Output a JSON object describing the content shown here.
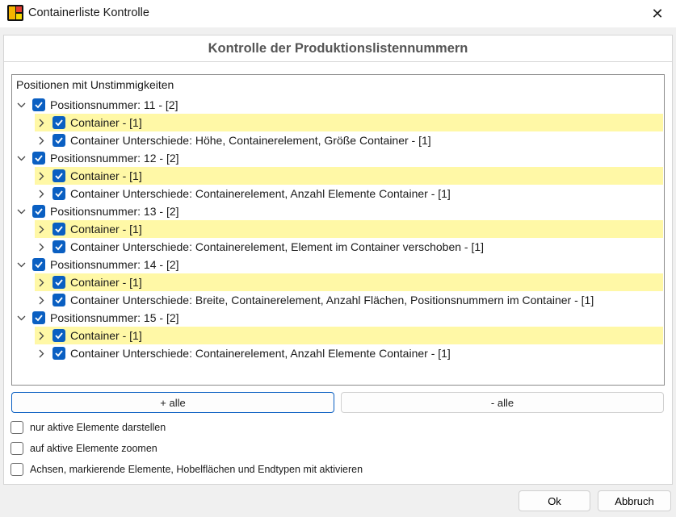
{
  "window": {
    "title": "Containerliste Kontrolle",
    "icon": "app-3d-icon",
    "close_icon": "close-icon"
  },
  "heading": "Kontrolle der Produktionslistennummern",
  "tree": {
    "caption": "Positionen mit Unstimmigkeiten",
    "groups": [
      {
        "label": "Positionsnummer: 11 - [2]",
        "children": [
          {
            "label": "Container  - [1]",
            "highlight": true
          },
          {
            "label": "Container Unterschiede: Höhe, Containerelement, Größe Container - [1]",
            "highlight": false
          }
        ]
      },
      {
        "label": "Positionsnummer: 12 - [2]",
        "children": [
          {
            "label": "Container  - [1]",
            "highlight": true
          },
          {
            "label": "Container Unterschiede: Containerelement, Anzahl Elemente Container - [1]",
            "highlight": false
          }
        ]
      },
      {
        "label": "Positionsnummer: 13 - [2]",
        "children": [
          {
            "label": "Container  - [1]",
            "highlight": true
          },
          {
            "label": "Container Unterschiede: Containerelement, Element im Container verschoben - [1]",
            "highlight": false
          }
        ]
      },
      {
        "label": "Positionsnummer: 14 - [2]",
        "children": [
          {
            "label": "Container  - [1]",
            "highlight": true
          },
          {
            "label": "Container Unterschiede: Breite, Containerelement, Anzahl Flächen, Positionsnummern im Container - [1]",
            "highlight": false
          }
        ]
      },
      {
        "label": "Positionsnummer: 15 - [2]",
        "children": [
          {
            "label": "Container  - [1]",
            "highlight": true
          },
          {
            "label": "Container Unterschiede: Containerelement, Anzahl Elemente Container - [1]",
            "highlight": false
          }
        ]
      }
    ]
  },
  "buttons": {
    "add_all": "+ alle",
    "remove_all": "- alle",
    "ok": "Ok",
    "cancel": "Abbruch"
  },
  "options": [
    {
      "label": "nur aktive Elemente darstellen",
      "checked": false
    },
    {
      "label": "auf aktive Elemente zoomen",
      "checked": false
    },
    {
      "label": "Achsen, markierende Elemente, Hobelflächen und Endtypen mit aktivieren",
      "checked": false
    }
  ],
  "colors": {
    "accent": "#0a5fc2",
    "highlight": "#fff8a6"
  }
}
